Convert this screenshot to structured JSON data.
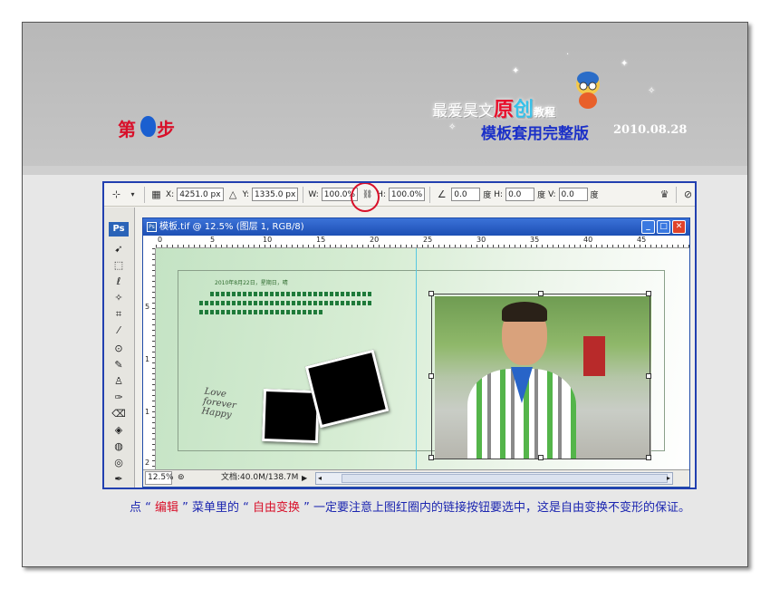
{
  "banner": {
    "step_prefix": "第",
    "step_suffix": "步",
    "brand_main": "最爱昊文",
    "brand_yuan": "原",
    "brand_chuang": "创",
    "brand_tail": "教程",
    "template_title": "模板套用完整版",
    "date": "2010.08.28"
  },
  "options_bar": {
    "x_label": "X:",
    "x_value": "4251.0 px",
    "y_label": "Y:",
    "y_value": "1335.0 px",
    "w_label": "W:",
    "w_value": "100.0%",
    "h_label": "H:",
    "h_value": "100.0%",
    "angle_value": "0.0",
    "angle_unit": "度",
    "hskew_label": "H:",
    "hskew_value": "0.0",
    "hskew_unit": "度",
    "vskew_label": "V:",
    "vskew_value": "0.0",
    "vskew_unit": "度"
  },
  "toolbox": {
    "logo": "Ps"
  },
  "document": {
    "title": "模板.tif @ 12.5% (图层 1, RGB/8)",
    "ruler_top": [
      "0",
      "5",
      "10",
      "15",
      "20",
      "25",
      "30",
      "35",
      "40",
      "45"
    ],
    "ruler_left": [
      "5",
      "1",
      "1",
      "2"
    ],
    "date_text": "2010年8月22日，星期日，晴",
    "love_text": [
      "Love",
      "forever",
      "Happy"
    ],
    "zoom": "12.5%",
    "doc_info": "文档:40.0M/138.7M"
  },
  "caption": {
    "p1": "点 “ ",
    "red1": "编辑",
    "p2": " ” 菜单里的 “ ",
    "red2": "自由变换",
    "p3": " ” 一定要注意上图红圈内的链接按钮要选中，这是自由变换不变形的保证。"
  },
  "colors": {
    "highlight_red": "#d8102a",
    "caption_blue": "#1b25b0",
    "ps_blue": "#2240b0"
  }
}
